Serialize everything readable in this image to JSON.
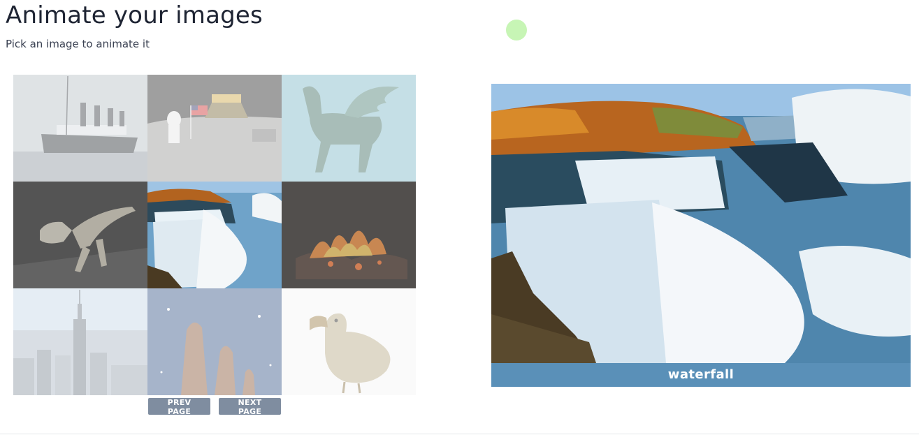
{
  "header": {
    "title": "Animate your images",
    "subtitle": "Pick an image to animate it"
  },
  "gallery": {
    "tiles": [
      {
        "id": "ship",
        "icon": "titanic-ship-image"
      },
      {
        "id": "moon",
        "icon": "moon-landing-image"
      },
      {
        "id": "pegasus",
        "icon": "pegasus-statue-image"
      },
      {
        "id": "dinosaur",
        "icon": "t-rex-skeleton-image"
      },
      {
        "id": "waterfall",
        "icon": "waterfall-image",
        "selected": true
      },
      {
        "id": "fire",
        "icon": "campfire-image"
      },
      {
        "id": "city",
        "icon": "empire-state-skyline-image"
      },
      {
        "id": "nebula",
        "icon": "pillars-of-creation-image"
      },
      {
        "id": "dodo",
        "icon": "dodo-bird-image"
      }
    ]
  },
  "pager": {
    "prev_label": "PREV PAGE",
    "next_label": "NEXT PAGE"
  },
  "preview": {
    "caption": "waterfall"
  },
  "colors": {
    "caption_bg": "#5a90b8",
    "button_bg": "#7f8da0",
    "cursor_dot": "#c7f5b5"
  }
}
